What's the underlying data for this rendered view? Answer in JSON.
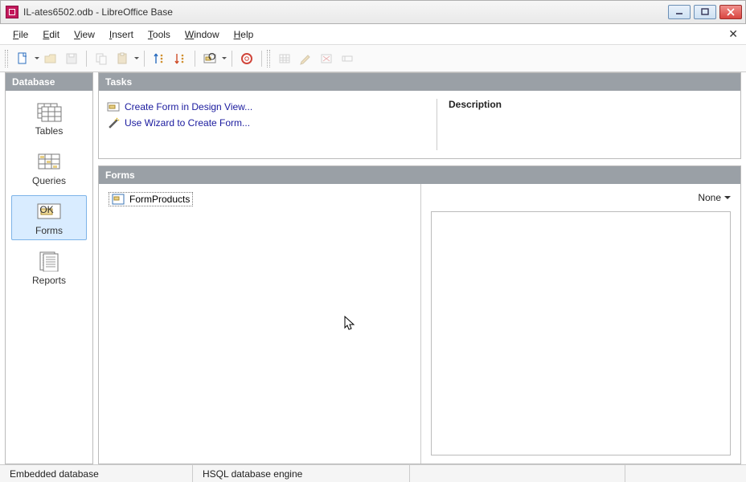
{
  "window": {
    "title": "IL-ates6502.odb - LibreOffice Base"
  },
  "menu": {
    "file": "File",
    "edit": "Edit",
    "view": "View",
    "insert": "Insert",
    "tools": "Tools",
    "window": "Window",
    "help": "Help"
  },
  "sidebar": {
    "header": "Database",
    "items": [
      {
        "label": "Tables"
      },
      {
        "label": "Queries"
      },
      {
        "label": "Forms"
      },
      {
        "label": "Reports"
      }
    ]
  },
  "tasks": {
    "header": "Tasks",
    "items": [
      {
        "label": "Create Form in Design View..."
      },
      {
        "label": "Use Wizard to Create Form..."
      }
    ],
    "description_label": "Description"
  },
  "forms": {
    "header": "Forms",
    "items": [
      {
        "label": "FormProducts"
      }
    ],
    "view_mode": "None"
  },
  "status": {
    "left": "Embedded database",
    "engine": "HSQL database engine"
  }
}
